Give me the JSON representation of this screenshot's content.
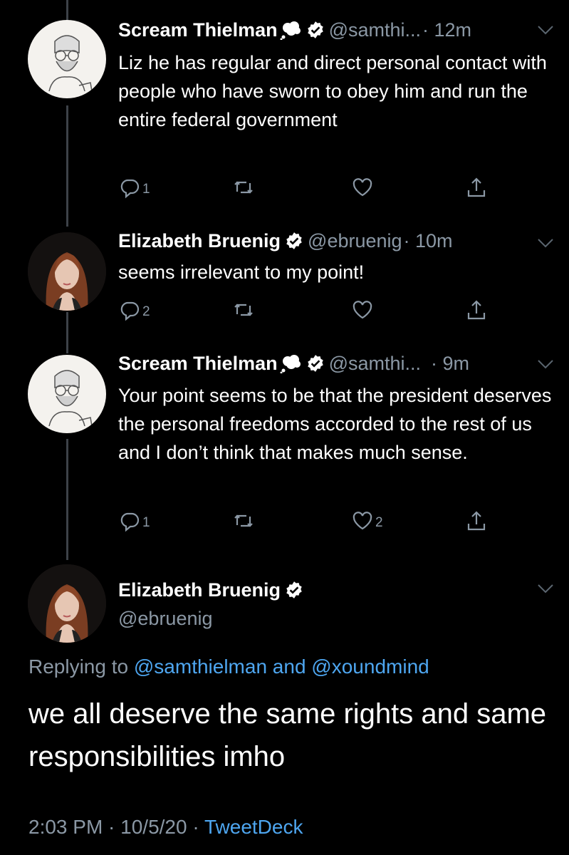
{
  "tweets": [
    {
      "name": "Scream Thielman",
      "handle": "@samthi...",
      "time": "· 12m",
      "text": "Liz he has regular and direct personal contact with people who have sworn to obey him and run the entire federal government",
      "reply_count": "1",
      "retweet_count": "",
      "like_count": ""
    },
    {
      "name": "Elizabeth Bruenig",
      "handle": "@ebruenig",
      "time": "· 10m",
      "text": "seems irrelevant to my point!",
      "reply_count": "2",
      "retweet_count": "",
      "like_count": ""
    },
    {
      "name": "Scream Thielman",
      "handle": "@samthi...",
      "time": "· 9m",
      "text": "Your point seems to be that the president deserves the personal freedoms accorded to the rest of us and I don’t think that makes much sense.",
      "reply_count": "1",
      "retweet_count": "",
      "like_count": "2"
    }
  ],
  "main_tweet": {
    "name": "Elizabeth Bruenig",
    "handle": "@ebruenig",
    "replying_prefix": "Replying to",
    "replying_users": "@samthielman and @xoundmind",
    "text": "we all deserve the same rights and same responsibilities imho",
    "timestamp": "2:03 PM · 10/5/20 ·",
    "source": "TweetDeck"
  },
  "icons": {
    "verified": "verified-badge-icon",
    "reply": "reply-icon",
    "retweet": "retweet-icon",
    "like": "heart-icon",
    "share": "share-icon",
    "more": "chevron-down-icon",
    "cloud": "thought-cloud-emoji-icon"
  },
  "colors": {
    "background": "#000000",
    "text": "#ffffff",
    "secondary": "#8b98a5",
    "link": "#4ea6f0",
    "thread_line": "#3d4248"
  }
}
